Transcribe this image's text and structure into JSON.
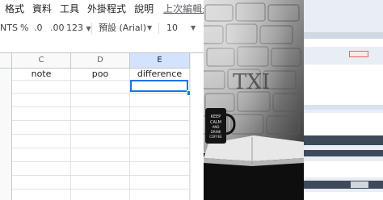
{
  "menubar": {
    "items": [
      "格式",
      "資料",
      "工具",
      "外掛程式",
      "說明"
    ],
    "last_edit": "上次編輯是在"
  },
  "toolbar": {
    "format_clip": "NTS",
    "percent": "%",
    "decrease_decimal": ".0",
    "increase_decimal": ".00",
    "more_formats": "123",
    "font_family": "預設 (Arial)",
    "font_size": "10"
  },
  "columns": [
    {
      "letter": "C",
      "value": "note",
      "selected": false
    },
    {
      "letter": "D",
      "value": "poo",
      "selected": false
    },
    {
      "letter": "E",
      "value": "difference",
      "selected": true
    }
  ],
  "active_cell": "E2",
  "photo": {
    "wall_text": "TXI",
    "mug_text": [
      "KEEP",
      "CALM",
      "AND",
      "DRINK",
      "COFFEE"
    ]
  },
  "colors": {
    "accent": "#1a73e8",
    "header_bg": "#f8f9fa",
    "selected_header": "#d3e3fd",
    "grid_line": "#e2e3e3"
  }
}
